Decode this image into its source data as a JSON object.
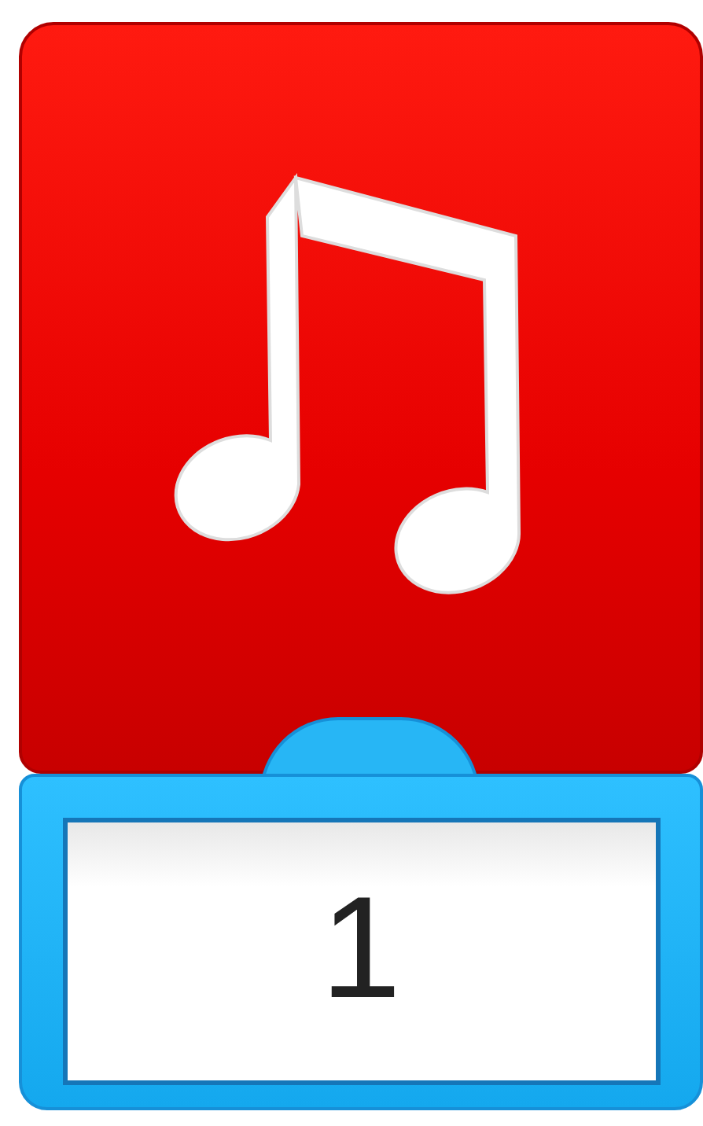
{
  "block": {
    "value": "1"
  }
}
